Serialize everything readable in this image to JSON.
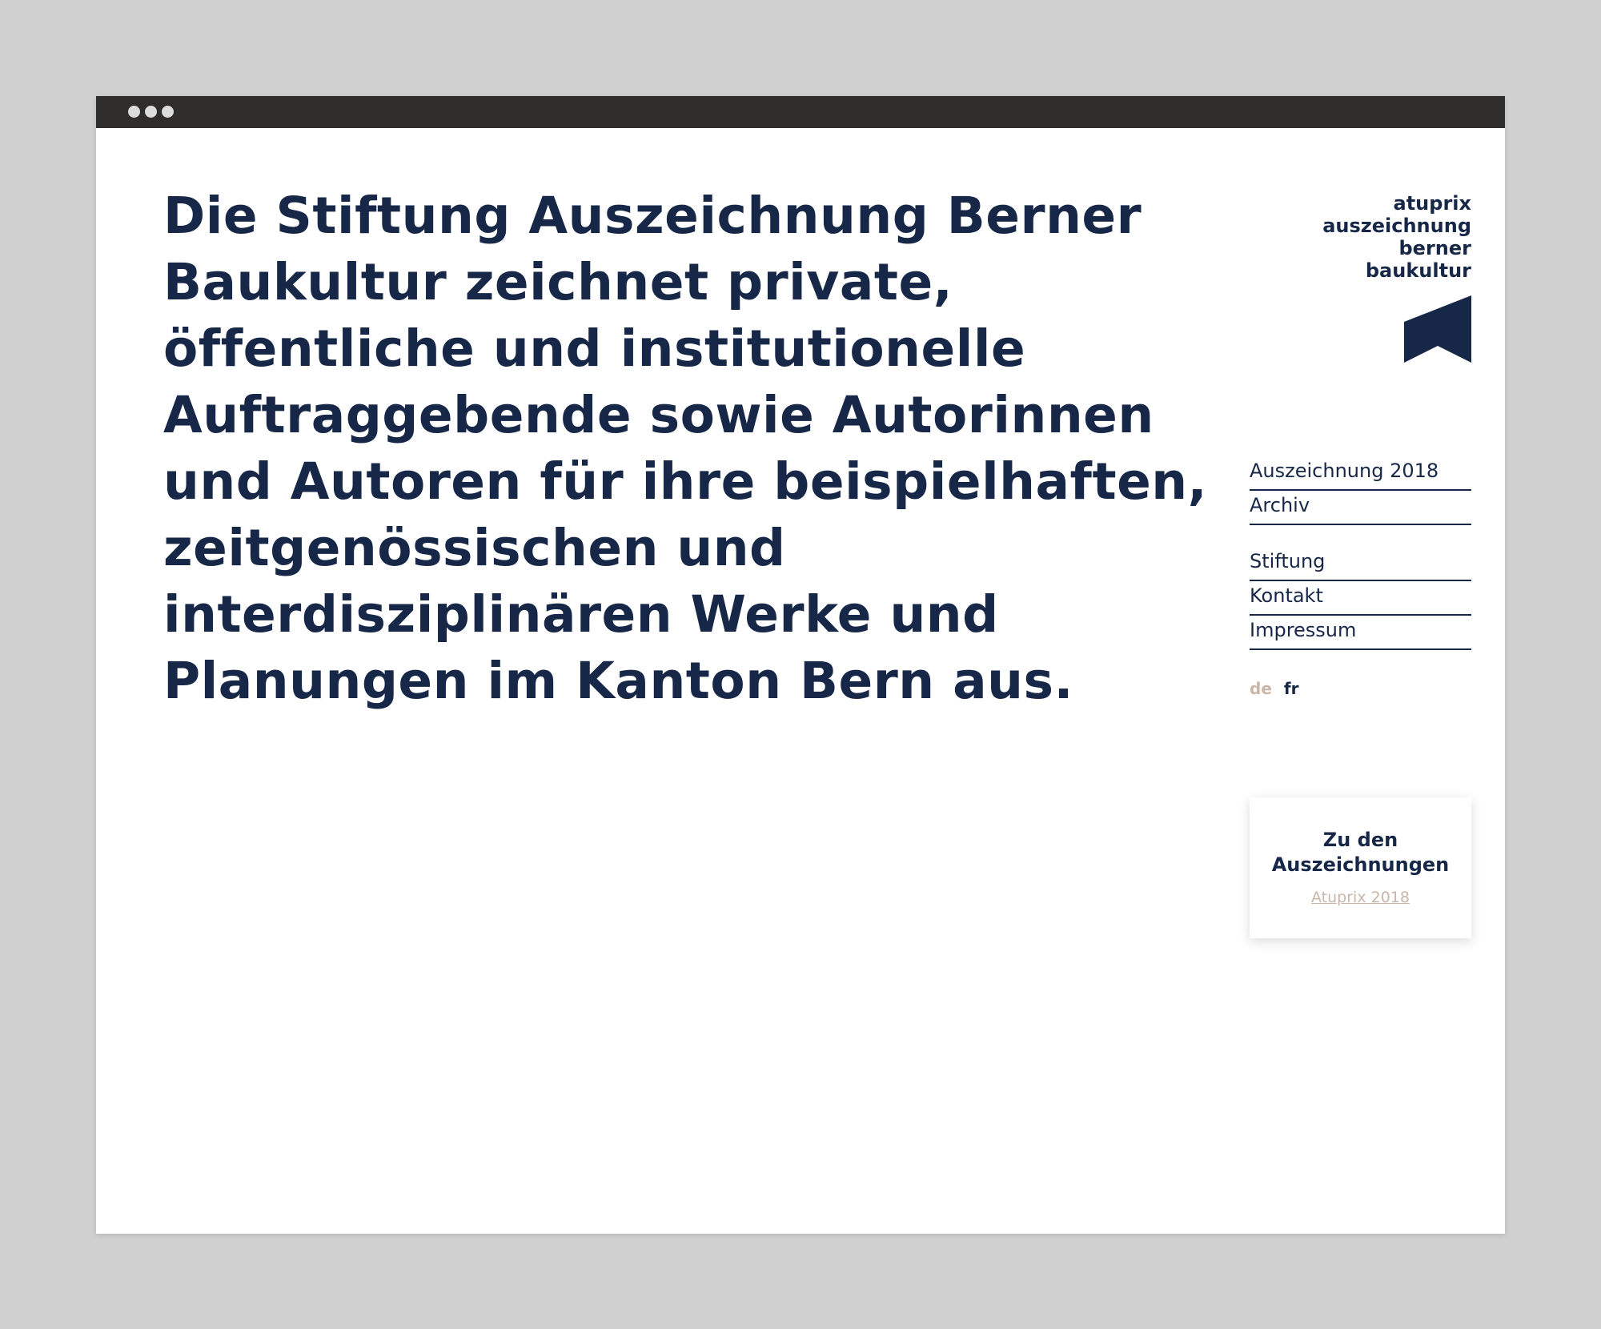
{
  "window": {
    "title_dots": [
      "dot-1",
      "dot-2",
      "dot-3"
    ]
  },
  "main": {
    "intro": "Die Stiftung Auszeichnung Berner Baukultur zeichnet private, öffentliche und institutionelle Auftraggebende sowie Autorinnen und Autoren für ihre beispielhaften, zeitgenössischen und interdisziplinären Werke und Planungen im Kanton Bern aus."
  },
  "brand": {
    "lines": [
      "atuprix",
      "auszeichnung",
      "berner",
      "baukultur"
    ],
    "logo_icon": "flag-logo-icon",
    "logo_color": "#172747"
  },
  "nav": {
    "primary": [
      {
        "label": "Auszeichnung 2018"
      },
      {
        "label": "Archiv"
      }
    ],
    "secondary": [
      {
        "label": "Stiftung"
      },
      {
        "label": "Kontakt"
      },
      {
        "label": "Impressum"
      }
    ]
  },
  "language": {
    "options": [
      "de",
      "fr"
    ],
    "active": "de"
  },
  "card": {
    "title": "Zu den Auszeichnungen",
    "link_label": "Atuprix 2018"
  },
  "colors": {
    "primary": "#172747",
    "accent": "#c9b6a8",
    "titlebar": "#2e2d2c",
    "background": "#d0d0d0"
  }
}
